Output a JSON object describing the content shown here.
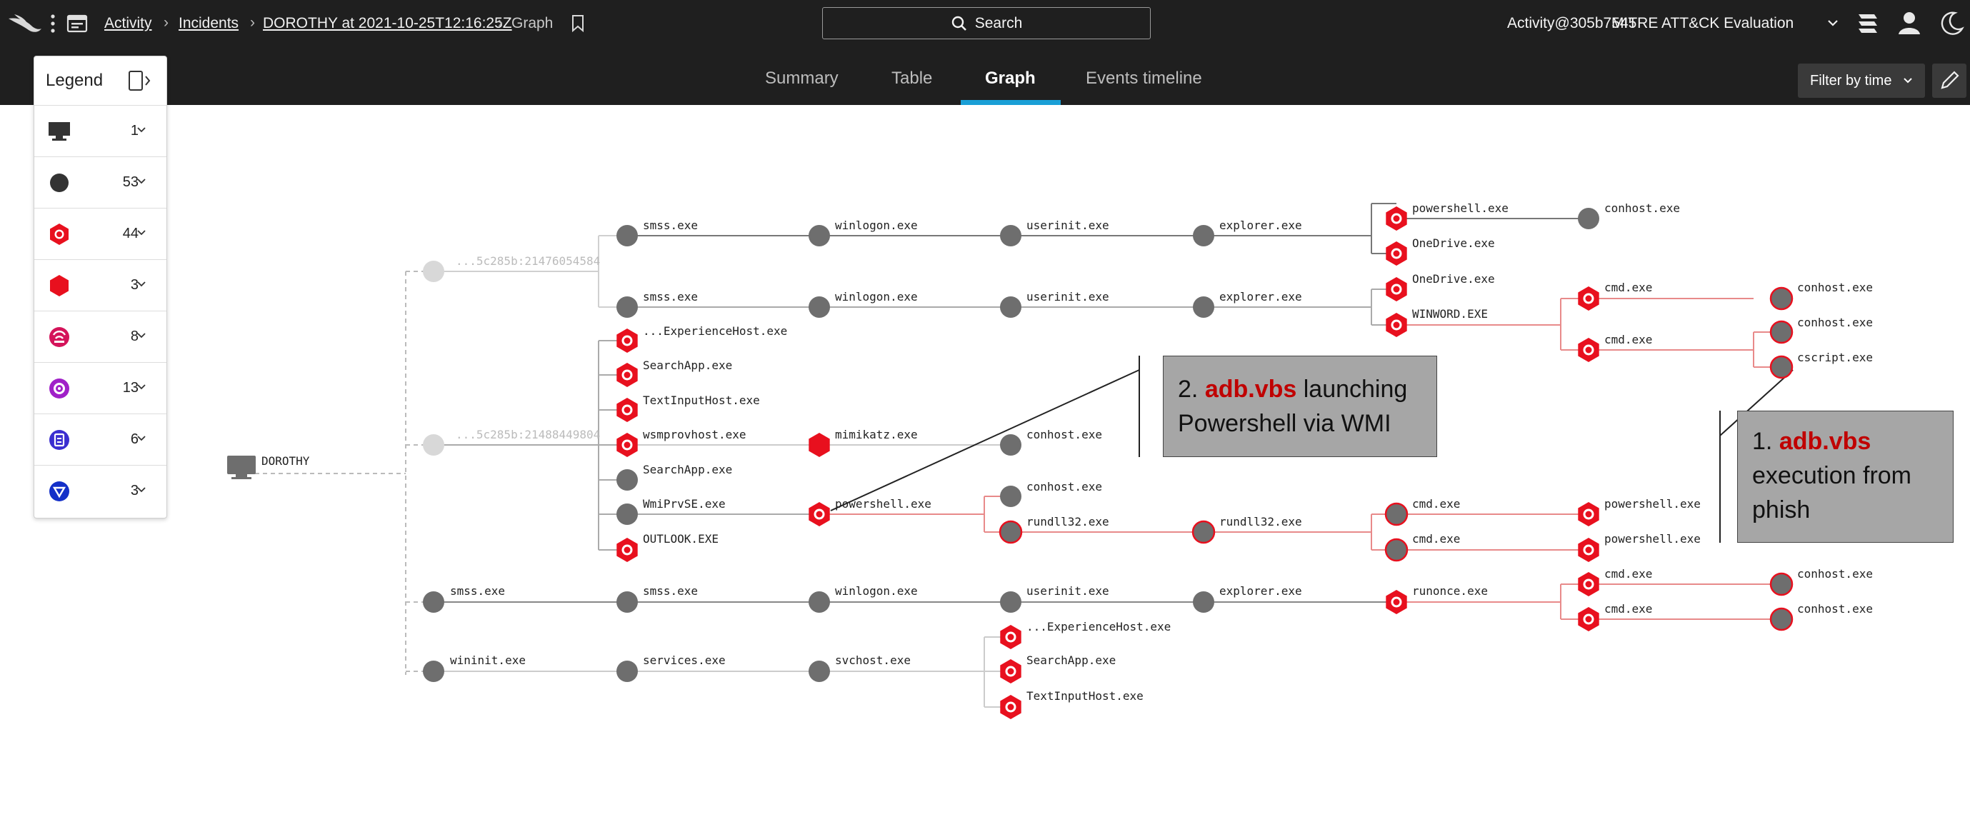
{
  "header": {
    "breadcrumbs": [
      "Activity",
      "Incidents",
      "DOROTHY at 2021-10-25T12:16:25Z",
      "Graph"
    ],
    "search_label": "Search",
    "account": "Activity@305b7545",
    "workspace": "MITRE ATT&CK Evaluation"
  },
  "tabs": [
    {
      "label": "Summary",
      "active": false
    },
    {
      "label": "Table",
      "active": false
    },
    {
      "label": "Graph",
      "active": true
    },
    {
      "label": "Events timeline",
      "active": false
    }
  ],
  "toolbar": {
    "filter_label": "Filter by time"
  },
  "legend": {
    "title": "Legend",
    "rows": [
      {
        "icon": "host-icon",
        "count": "1"
      },
      {
        "icon": "process-icon",
        "count": "53"
      },
      {
        "icon": "detection-icon",
        "count": "44"
      },
      {
        "icon": "critical-detection-icon",
        "count": "3"
      },
      {
        "icon": "network-icon",
        "count": "8"
      },
      {
        "icon": "target-icon",
        "count": "13"
      },
      {
        "icon": "file-icon",
        "count": "6"
      },
      {
        "icon": "alert-triangle-icon",
        "count": "3"
      }
    ]
  },
  "graph": {
    "host": "DOROTHY",
    "sessions": [
      "...5c285b:21476054584",
      "...5c285b:21488449804"
    ],
    "process_labels": [
      "smss.exe",
      "winlogon.exe",
      "userinit.exe",
      "explorer.exe",
      "powershell.exe",
      "conhost.exe",
      "OneDrive.exe",
      "smss.exe",
      "winlogon.exe",
      "userinit.exe",
      "explorer.exe",
      "OneDrive.exe",
      "WINWORD.EXE",
      "cmd.exe",
      "conhost.exe",
      "cmd.exe",
      "conhost.exe",
      "cscript.exe",
      "...ExperienceHost.exe",
      "SearchApp.exe",
      "TextInputHost.exe",
      "wsmprovhost.exe",
      "mimikatz.exe",
      "conhost.exe",
      "SearchApp.exe",
      "WmiPrvSE.exe",
      "powershell.exe",
      "conhost.exe",
      "rundll32.exe",
      "rundll32.exe",
      "cmd.exe",
      "powershell.exe",
      "cmd.exe",
      "powershell.exe",
      "OUTLOOK.EXE",
      "smss.exe",
      "smss.exe",
      "winlogon.exe",
      "userinit.exe",
      "explorer.exe",
      "runonce.exe",
      "cmd.exe",
      "conhost.exe",
      "cmd.exe",
      "conhost.exe",
      "wininit.exe",
      "services.exe",
      "svchost.exe",
      "...ExperienceHost.exe",
      "SearchApp.exe",
      "TextInputHost.exe"
    ]
  },
  "callouts": [
    {
      "prefix": "2. ",
      "highlight": "adb.vbs",
      "text": " launching Powershell via WMI"
    },
    {
      "prefix": "1. ",
      "highlight": "adb.vbs",
      "text": " execution from phish"
    }
  ],
  "colors": {
    "topbar": "#1f1f1f",
    "accent": "#1a9fd6",
    "detection": "#e8101e",
    "process": "#6e6e6e",
    "callout": "#a6a6a6"
  }
}
